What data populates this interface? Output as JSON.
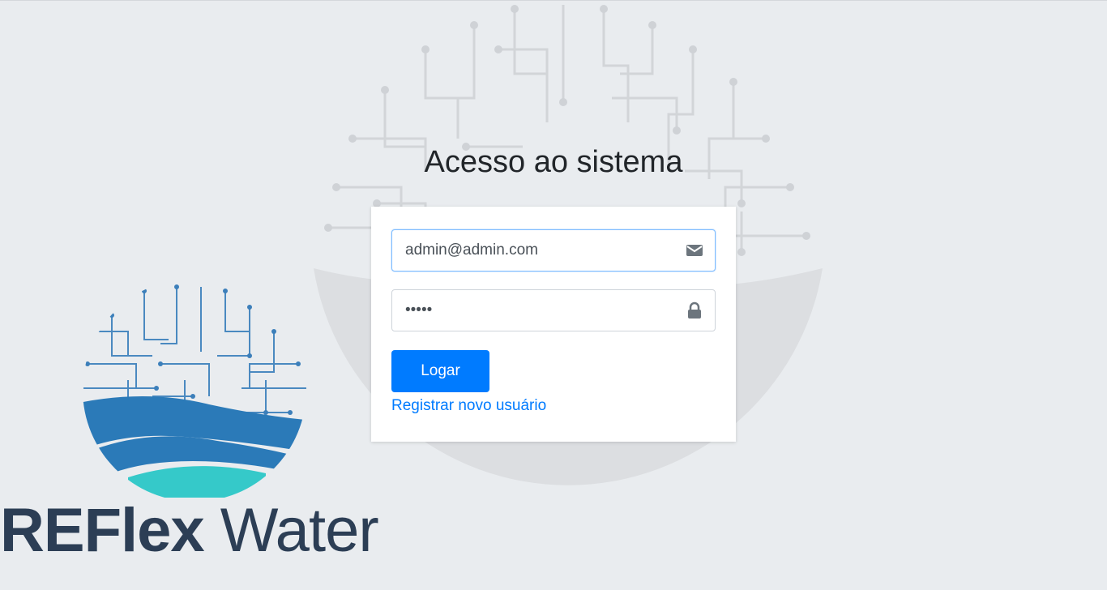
{
  "login": {
    "title": "Acesso ao sistema",
    "email_value": "admin@admin.com",
    "email_icon": "envelope-icon",
    "password_value": "admin",
    "password_icon": "lock-icon",
    "submit_label": "Logar",
    "register_link": "Registrar novo usuário"
  },
  "brand": {
    "name_bold": "REFlex",
    "name_light": " Water"
  },
  "colors": {
    "background": "#e9ecef",
    "primary": "#007bff",
    "brand_dark": "#2c3e55",
    "logo_blue": "#2b7ab8",
    "logo_teal": "#35c9c9"
  }
}
